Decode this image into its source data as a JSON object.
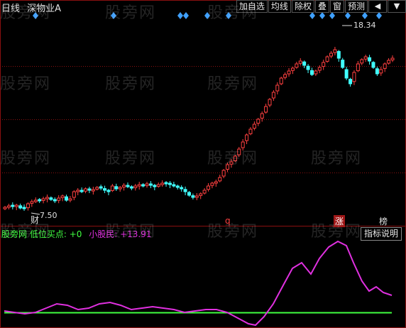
{
  "header": {
    "period": "日线",
    "stock_name": "深物业A"
  },
  "toolbar": {
    "items": [
      "加自选",
      "均线",
      "除权",
      "叠",
      "窗",
      "预测"
    ],
    "arrow_left": "◀",
    "arrow_right": "▼"
  },
  "annotations": {
    "high_price": "18.34",
    "low_price": "7.50",
    "mark_cai": "财",
    "mark_q": "q",
    "mark_zhang": "涨",
    "mark_bang": "榜"
  },
  "indicator": {
    "name": "股旁网 低位买点:",
    "value1": "+0",
    "name2": "小股民:",
    "value2": "+13.91",
    "help_label": "指标说明"
  },
  "watermark": "股旁网",
  "colors": {
    "up": "#ff4040",
    "down": "#40ffff",
    "diamond": "#3fa0ff",
    "line_magenta": "#e030e0",
    "line_green": "#40ff40",
    "grid": "#8a1010"
  },
  "chart_data": {
    "type": "candlestick",
    "price_labels": {
      "high": 18.34,
      "low": 7.5
    },
    "indicator_series": [
      {
        "name": "小股民",
        "color": "magenta"
      },
      {
        "name": "低位买点",
        "color": "green",
        "value": 0
      }
    ]
  }
}
